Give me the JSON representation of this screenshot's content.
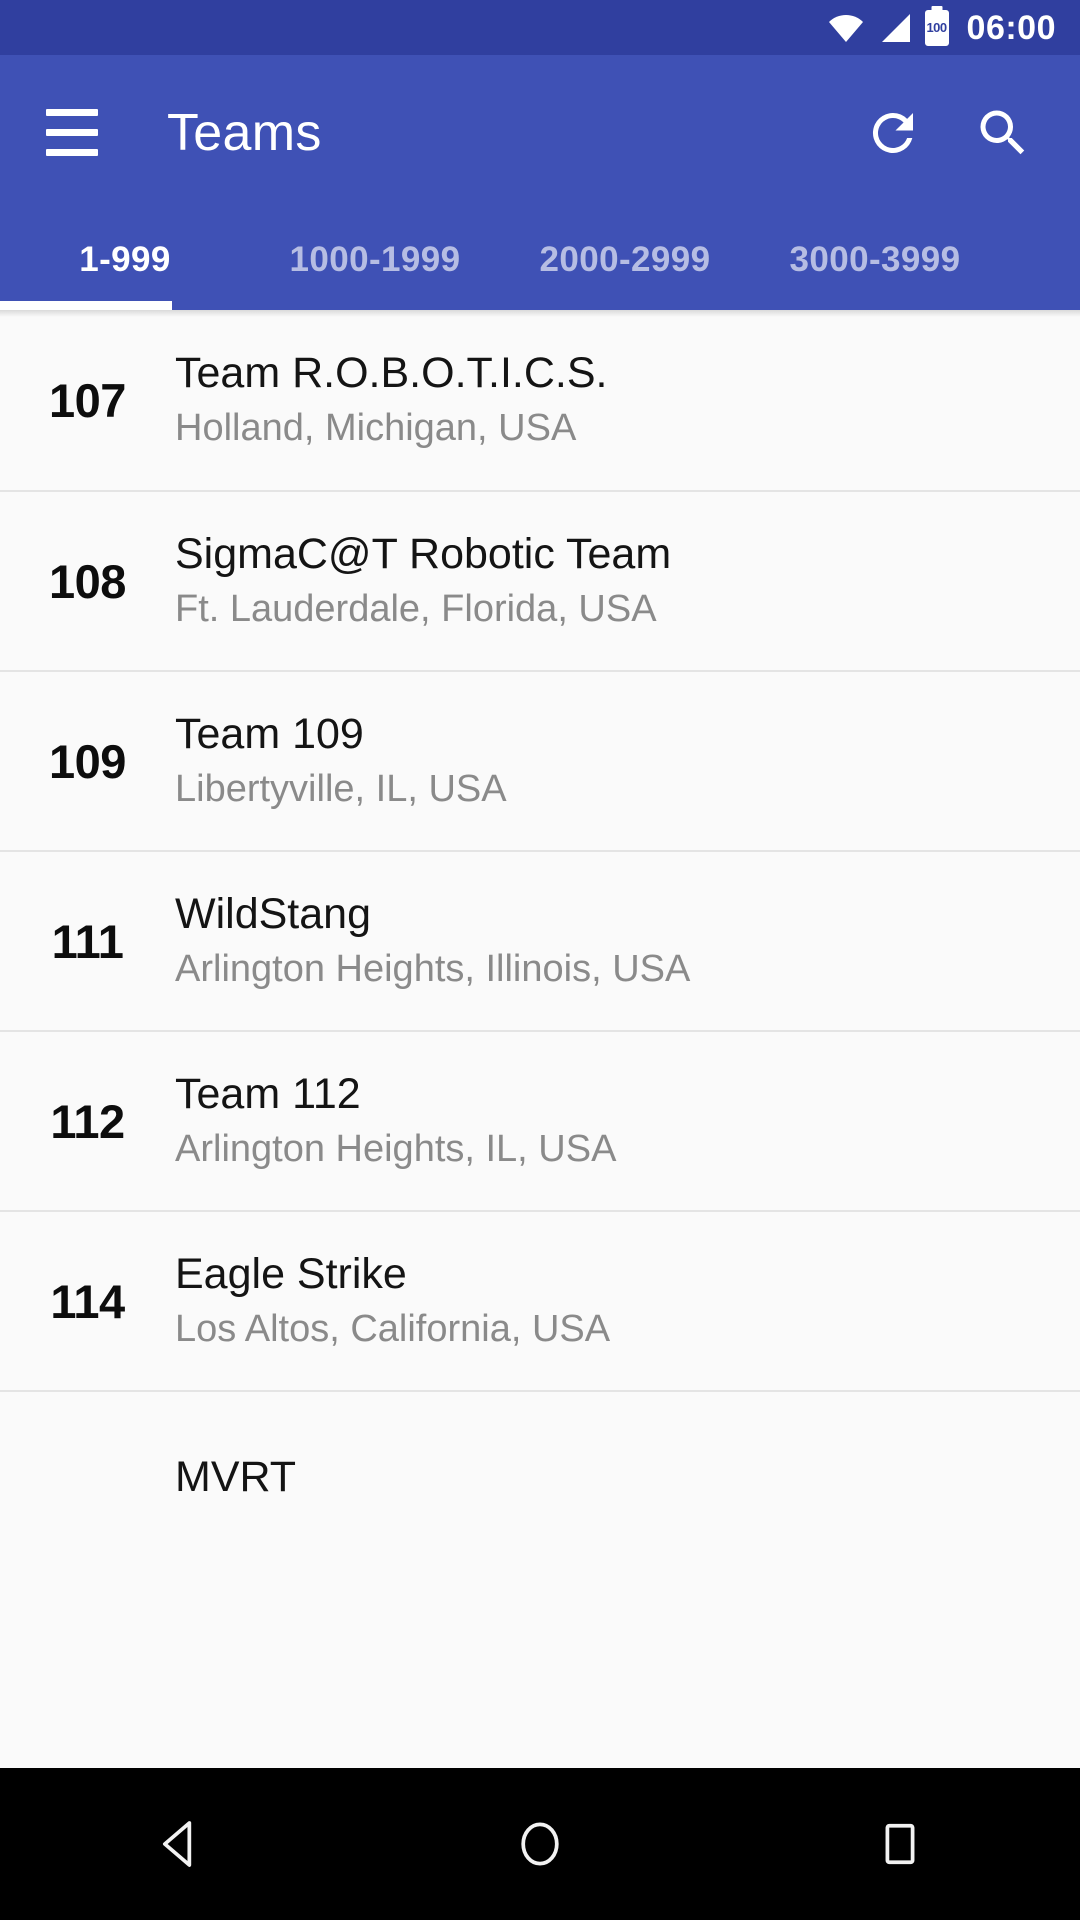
{
  "status_bar": {
    "wifi_icon": "wifi-icon",
    "signal_icon": "cellular-signal-icon",
    "battery_icon": "battery-icon",
    "battery_level": "100",
    "time": "06:00"
  },
  "toolbar": {
    "menu_icon": "hamburger-menu-icon",
    "title": "Teams",
    "refresh_icon": "refresh-icon",
    "search_icon": "search-icon"
  },
  "tabs": {
    "items": [
      {
        "label": "1-999",
        "active": true
      },
      {
        "label": "1000-1999",
        "active": false
      },
      {
        "label": "2000-2999",
        "active": false
      },
      {
        "label": "3000-3999",
        "active": false
      }
    ]
  },
  "team_list": {
    "rows": [
      {
        "number": "107",
        "name": "Team R.O.B.O.T.I.C.S.",
        "location": "Holland, Michigan, USA"
      },
      {
        "number": "108",
        "name": "SigmaC@T Robotic Team",
        "location": "Ft. Lauderdale, Florida, USA"
      },
      {
        "number": "109",
        "name": "Team 109",
        "location": "Libertyville, IL, USA"
      },
      {
        "number": "111",
        "name": "WildStang",
        "location": "Arlington Heights, Illinois, USA"
      },
      {
        "number": "112",
        "name": "Team 112",
        "location": "Arlington Heights, IL, USA"
      },
      {
        "number": "114",
        "name": "Eagle Strike",
        "location": "Los Altos, California, USA"
      },
      {
        "number": "",
        "name": "MVRT",
        "location": ""
      }
    ]
  },
  "nav_bar": {
    "back_icon": "back-triangle-icon",
    "home_icon": "home-circle-icon",
    "recents_icon": "recents-square-icon"
  },
  "colors": {
    "status_bar_bg": "#303f9f",
    "app_bar_bg": "#3f51b5",
    "list_bg": "#fafafa",
    "divider": "#e4e4e4",
    "primary_text": "#141414",
    "secondary_text": "#8a8a8a",
    "nav_bar_bg": "#000000"
  }
}
